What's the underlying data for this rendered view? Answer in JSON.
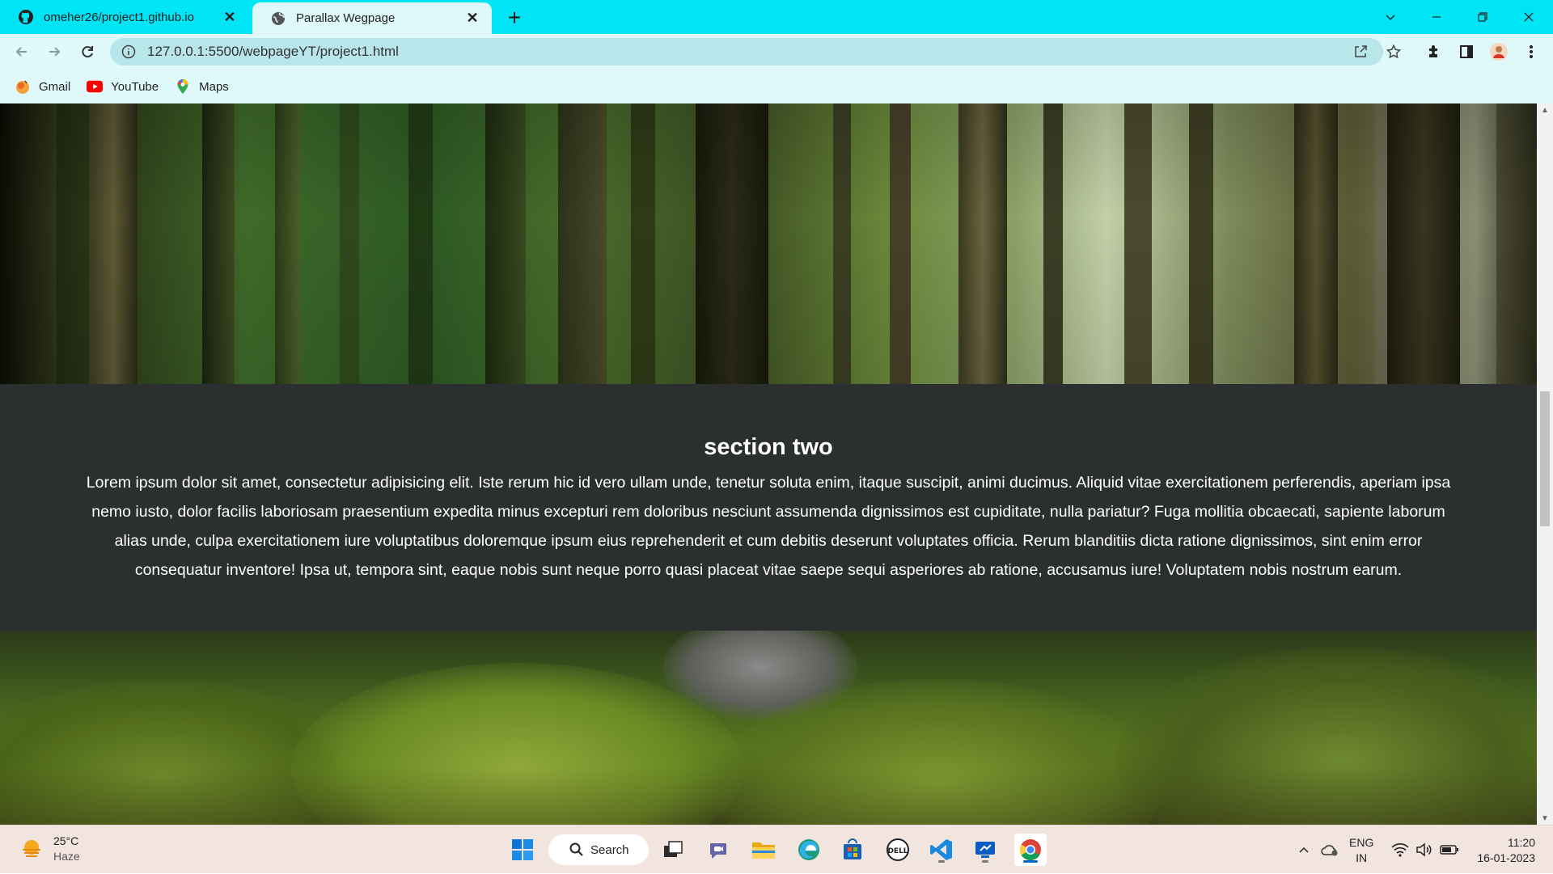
{
  "browser": {
    "tabs": [
      {
        "title": "omeher26/project1.github.io",
        "icon": "github-icon",
        "active": false
      },
      {
        "title": "Parallax Wegpage",
        "icon": "globe-icon",
        "active": true
      }
    ],
    "url": "127.0.0.1:5500/webpageYT/project1.html",
    "bookmarks": [
      {
        "label": "Gmail",
        "icon": "gmail-icon"
      },
      {
        "label": "YouTube",
        "icon": "youtube-icon"
      },
      {
        "label": "Maps",
        "icon": "maps-icon"
      }
    ],
    "colors": {
      "tabstrip": "#00e5f5",
      "toolbar": "#dff9fb"
    }
  },
  "page": {
    "section_two": {
      "heading": "section two",
      "body": "Lorem ipsum dolor sit amet, consectetur adipisicing elit. Iste rerum hic id vero ullam unde, tenetur soluta enim, itaque suscipit, animi ducimus. Aliquid vitae exercitationem perferendis, aperiam ipsa nemo iusto, dolor facilis laboriosam praesentium expedita minus excepturi rem doloribus nesciunt assumenda dignissimos est cupiditate, nulla pariatur? Fuga mollitia obcaecati, sapiente laborum alias unde, culpa exercitationem iure voluptatibus doloremque ipsum eius reprehenderit et cum debitis deserunt voluptates officia. Rerum blanditiis dicta ratione dignissimos, sint enim error consequatur inventore! Ipsa ut, tempora sint, eaque nobis sunt neque porro quasi placeat vitae saepe sequi asperiores ab ratione, accusamus iure! Voluptatem nobis nostrum earum.",
      "background": "#2b2f30"
    },
    "images": [
      "forest-image",
      "moss-image"
    ]
  },
  "taskbar": {
    "weather": {
      "temp": "25°C",
      "condition": "Haze"
    },
    "search_label": "Search",
    "apps": [
      "start-icon",
      "task-view-icon",
      "teams-chat-icon",
      "file-explorer-icon",
      "edge-icon",
      "store-icon",
      "dell-icon",
      "vscode-icon",
      "remote-icon",
      "chrome-icon"
    ],
    "language": {
      "line1": "ENG",
      "line2": "IN"
    },
    "time": "11:20",
    "date": "16-01-2023"
  }
}
